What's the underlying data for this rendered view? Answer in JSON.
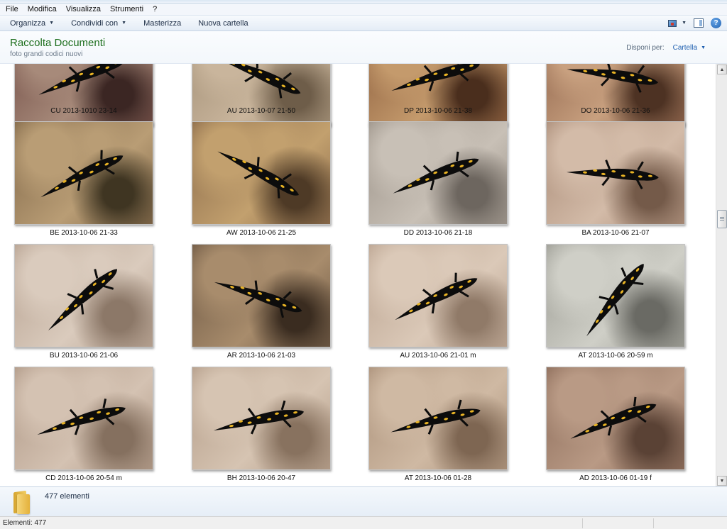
{
  "menu": {
    "items": [
      "File",
      "Modifica",
      "Visualizza",
      "Strumenti",
      "?"
    ]
  },
  "toolbar": {
    "organize": "Organizza",
    "share": "Condividi con",
    "burn": "Masterizza",
    "new_folder": "Nuova cartella"
  },
  "library": {
    "title": "Raccolta Documenti",
    "subtitle": "foto grandi codici nuovi",
    "arrange_label": "Disponi per:",
    "arrange_value": "Cartella"
  },
  "files": [
    {
      "name": "CU 2013-1010 23-14",
      "palette": [
        "#6f4a43",
        "#a78a7a",
        "#3b2623"
      ]
    },
    {
      "name": "AU 2013-10-07 21-50",
      "palette": [
        "#a08d74",
        "#c9b59c",
        "#6e5d49"
      ]
    },
    {
      "name": "DP 2013-10-06 21-38",
      "palette": [
        "#8a5c3c",
        "#c49a6c",
        "#4a2e1d"
      ]
    },
    {
      "name": "DO 2013-10-06 21-36",
      "palette": [
        "#8b6048",
        "#c8a07f",
        "#4d3223"
      ]
    },
    {
      "name": "BE 2013-10-06 21-33",
      "palette": [
        "#7f6648",
        "#b99d75",
        "#3f3522"
      ]
    },
    {
      "name": "AW 2013-10-06 21-25",
      "palette": [
        "#8a6a4a",
        "#c2a06e",
        "#4e3a26"
      ]
    },
    {
      "name": "DD 2013-10-06 21-18",
      "palette": [
        "#9b9288",
        "#c8c0b6",
        "#6d665f"
      ]
    },
    {
      "name": "BA 2013-10-06 21-07",
      "palette": [
        "#a88a76",
        "#d3bba8",
        "#745a49"
      ]
    },
    {
      "name": "BU 2013-10-06 21-06",
      "palette": [
        "#b5a08f",
        "#dacbbd",
        "#8c7868"
      ]
    },
    {
      "name": "AR 2013-10-06 21-03",
      "palette": [
        "#6b5642",
        "#a88c6c",
        "#3a2c20"
      ]
    },
    {
      "name": "AU 2013-10-06 21-01 m",
      "palette": [
        "#b9a28f",
        "#dbc9b8",
        "#907a68"
      ]
    },
    {
      "name": "AT 2013-10-06 20-59 m",
      "palette": [
        "#9a9a92",
        "#cfcfc7",
        "#6a6a64"
      ]
    },
    {
      "name": "CD  2013-10-06 20-54 m",
      "palette": [
        "#ae9785",
        "#d4c2b2",
        "#85705f"
      ]
    },
    {
      "name": "BH 2013-10-06 20-47",
      "palette": [
        "#b29b87",
        "#d6c4b2",
        "#88725f"
      ]
    },
    {
      "name": "AT 2013-10-06 01-28",
      "palette": [
        "#a98f78",
        "#cfb9a3",
        "#7e6652"
      ]
    },
    {
      "name": "AD 2013-10-06 01-19 f",
      "palette": [
        "#8a6a58",
        "#b99a85",
        "#5a4235"
      ]
    }
  ],
  "details": {
    "count": "477 elementi"
  },
  "status": {
    "text": "Elementi: 477"
  }
}
